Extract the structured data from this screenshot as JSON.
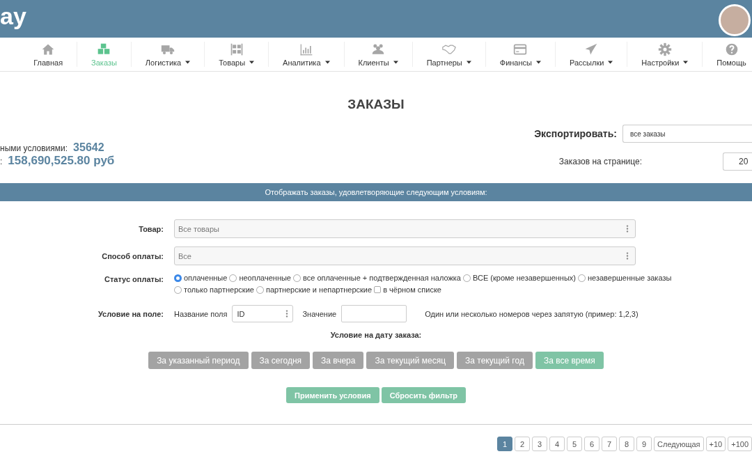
{
  "header": {
    "logo": "ay"
  },
  "nav": [
    {
      "label": "Главная",
      "selected": false,
      "dropdown": false
    },
    {
      "label": "Заказы",
      "selected": true,
      "dropdown": false
    },
    {
      "label": "Логистика",
      "selected": false,
      "dropdown": true
    },
    {
      "label": "Товары",
      "selected": false,
      "dropdown": true
    },
    {
      "label": "Аналитика",
      "selected": false,
      "dropdown": true
    },
    {
      "label": "Клиенты",
      "selected": false,
      "dropdown": true
    },
    {
      "label": "Партнеры",
      "selected": false,
      "dropdown": true
    },
    {
      "label": "Финансы",
      "selected": false,
      "dropdown": true
    },
    {
      "label": "Рассылки",
      "selected": false,
      "dropdown": true
    },
    {
      "label": "Настройки",
      "selected": false,
      "dropdown": true
    },
    {
      "label": "Помощь",
      "selected": false,
      "dropdown": false
    }
  ],
  "page_title": "ЗАКАЗЫ",
  "summary": [
    {
      "label": "ными условиями:",
      "value": "35642"
    },
    {
      "label": ":",
      "value": "158,690,525.80 руб"
    }
  ],
  "export": {
    "label": "Экспортировать:",
    "value": "все заказы"
  },
  "per_page": {
    "label": "Заказов на странице:",
    "value": "20"
  },
  "filter_bar": "Отображать заказы, удовлетворяющие следующим условиям:",
  "product": {
    "label": "Товар:",
    "placeholder": "Все товары"
  },
  "payment_method": {
    "label": "Способ оплаты:",
    "placeholder": "Все"
  },
  "payment_status": {
    "label": "Статус оплаты:",
    "options": [
      {
        "kind": "radio",
        "label": "оплаченные",
        "selected": true
      },
      {
        "kind": "radio",
        "label": "неоплаченные",
        "selected": false
      },
      {
        "kind": "radio",
        "label": "все оплаченные + подтвержденная наложка",
        "selected": false
      },
      {
        "kind": "radio",
        "label": "ВСЕ (кроме незавершенных)",
        "selected": false
      },
      {
        "kind": "radio",
        "label": "незавершенные заказы",
        "selected": false
      },
      {
        "kind": "radio",
        "label": "только партнерские",
        "selected": false
      },
      {
        "kind": "radio",
        "label": "партнерские и непартнерские",
        "selected": false
      },
      {
        "kind": "checkbox",
        "label": "в чёрном списке",
        "selected": false
      }
    ]
  },
  "field_condition": {
    "label": "Условие на поле:",
    "name_label": "Название поля",
    "name_value": "ID",
    "value_label": "Значение",
    "hint": "Один или несколько номеров через запятую (пример: 1,2,3)"
  },
  "date_condition": {
    "label": "Условие на дату заказа:",
    "buttons": [
      {
        "label": "За указанный период",
        "selected": false
      },
      {
        "label": "За сегодня",
        "selected": false
      },
      {
        "label": "За вчера",
        "selected": false
      },
      {
        "label": "За текущий месяц",
        "selected": false
      },
      {
        "label": "За текущий год",
        "selected": false
      },
      {
        "label": "За все время",
        "selected": true
      }
    ]
  },
  "actions": [
    "Применить условия",
    "Сбросить фильтр"
  ],
  "pagination": [
    {
      "label": "1",
      "selected": true
    },
    {
      "label": "2",
      "selected": false
    },
    {
      "label": "3",
      "selected": false
    },
    {
      "label": "4",
      "selected": false
    },
    {
      "label": "5",
      "selected": false
    },
    {
      "label": "6",
      "selected": false
    },
    {
      "label": "7",
      "selected": false
    },
    {
      "label": "8",
      "selected": false
    },
    {
      "label": "9",
      "selected": false
    },
    {
      "label": "Следующая",
      "selected": false
    },
    {
      "label": "+10",
      "selected": false
    },
    {
      "label": "+100",
      "selected": false
    }
  ]
}
